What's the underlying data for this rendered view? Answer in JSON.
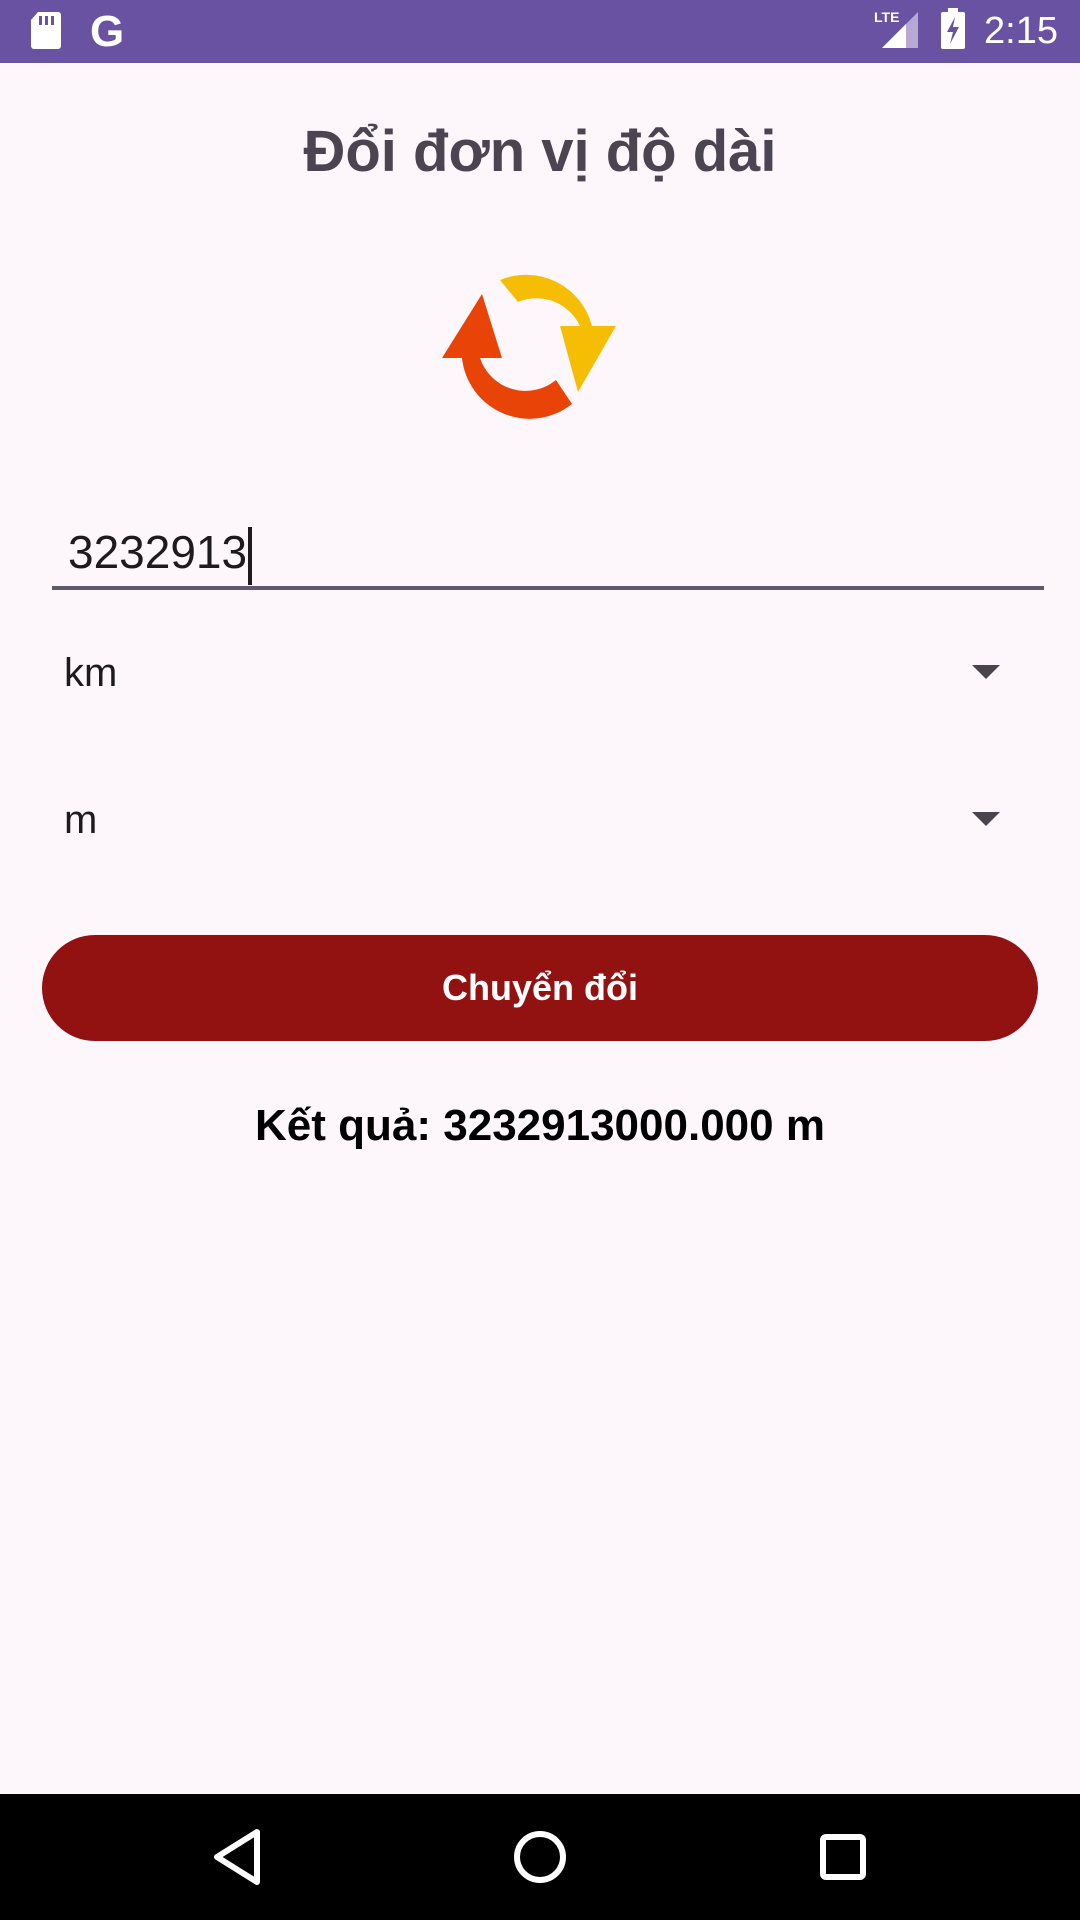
{
  "status_bar": {
    "time": "2:15",
    "network": "LTE",
    "google_letter": "G",
    "background_color": "#6a52a2"
  },
  "title": "Đổi đơn vị độ dài",
  "input": {
    "value": "3232913"
  },
  "from_unit": {
    "selected": "km"
  },
  "to_unit": {
    "selected": "m"
  },
  "convert_button": {
    "label": "Chuyển đổi",
    "color": "#921212"
  },
  "result": "Kết quả: 3232913000.000 m",
  "icons": {
    "logo": "sync-arrows-icon",
    "sd_card": "sd-card-icon",
    "signal": "cell-signal-icon",
    "battery": "battery-charging-icon",
    "back": "back-triangle-icon",
    "home": "home-circle-icon",
    "recents": "recents-square-icon"
  }
}
